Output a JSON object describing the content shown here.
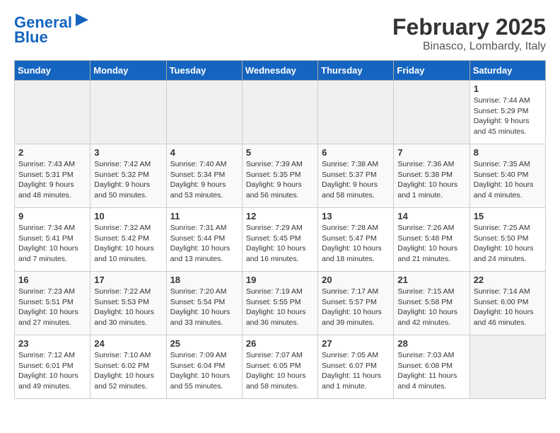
{
  "logo": {
    "line1": "General",
    "line2": "Blue"
  },
  "title": "February 2025",
  "subtitle": "Binasco, Lombardy, Italy",
  "weekdays": [
    "Sunday",
    "Monday",
    "Tuesday",
    "Wednesday",
    "Thursday",
    "Friday",
    "Saturday"
  ],
  "weeks": [
    [
      {
        "num": "",
        "info": ""
      },
      {
        "num": "",
        "info": ""
      },
      {
        "num": "",
        "info": ""
      },
      {
        "num": "",
        "info": ""
      },
      {
        "num": "",
        "info": ""
      },
      {
        "num": "",
        "info": ""
      },
      {
        "num": "1",
        "info": "Sunrise: 7:44 AM\nSunset: 5:29 PM\nDaylight: 9 hours and 45 minutes."
      }
    ],
    [
      {
        "num": "2",
        "info": "Sunrise: 7:43 AM\nSunset: 5:31 PM\nDaylight: 9 hours and 48 minutes."
      },
      {
        "num": "3",
        "info": "Sunrise: 7:42 AM\nSunset: 5:32 PM\nDaylight: 9 hours and 50 minutes."
      },
      {
        "num": "4",
        "info": "Sunrise: 7:40 AM\nSunset: 5:34 PM\nDaylight: 9 hours and 53 minutes."
      },
      {
        "num": "5",
        "info": "Sunrise: 7:39 AM\nSunset: 5:35 PM\nDaylight: 9 hours and 56 minutes."
      },
      {
        "num": "6",
        "info": "Sunrise: 7:38 AM\nSunset: 5:37 PM\nDaylight: 9 hours and 58 minutes."
      },
      {
        "num": "7",
        "info": "Sunrise: 7:36 AM\nSunset: 5:38 PM\nDaylight: 10 hours and 1 minute."
      },
      {
        "num": "8",
        "info": "Sunrise: 7:35 AM\nSunset: 5:40 PM\nDaylight: 10 hours and 4 minutes."
      }
    ],
    [
      {
        "num": "9",
        "info": "Sunrise: 7:34 AM\nSunset: 5:41 PM\nDaylight: 10 hours and 7 minutes."
      },
      {
        "num": "10",
        "info": "Sunrise: 7:32 AM\nSunset: 5:42 PM\nDaylight: 10 hours and 10 minutes."
      },
      {
        "num": "11",
        "info": "Sunrise: 7:31 AM\nSunset: 5:44 PM\nDaylight: 10 hours and 13 minutes."
      },
      {
        "num": "12",
        "info": "Sunrise: 7:29 AM\nSunset: 5:45 PM\nDaylight: 10 hours and 16 minutes."
      },
      {
        "num": "13",
        "info": "Sunrise: 7:28 AM\nSunset: 5:47 PM\nDaylight: 10 hours and 18 minutes."
      },
      {
        "num": "14",
        "info": "Sunrise: 7:26 AM\nSunset: 5:48 PM\nDaylight: 10 hours and 21 minutes."
      },
      {
        "num": "15",
        "info": "Sunrise: 7:25 AM\nSunset: 5:50 PM\nDaylight: 10 hours and 24 minutes."
      }
    ],
    [
      {
        "num": "16",
        "info": "Sunrise: 7:23 AM\nSunset: 5:51 PM\nDaylight: 10 hours and 27 minutes."
      },
      {
        "num": "17",
        "info": "Sunrise: 7:22 AM\nSunset: 5:53 PM\nDaylight: 10 hours and 30 minutes."
      },
      {
        "num": "18",
        "info": "Sunrise: 7:20 AM\nSunset: 5:54 PM\nDaylight: 10 hours and 33 minutes."
      },
      {
        "num": "19",
        "info": "Sunrise: 7:19 AM\nSunset: 5:55 PM\nDaylight: 10 hours and 36 minutes."
      },
      {
        "num": "20",
        "info": "Sunrise: 7:17 AM\nSunset: 5:57 PM\nDaylight: 10 hours and 39 minutes."
      },
      {
        "num": "21",
        "info": "Sunrise: 7:15 AM\nSunset: 5:58 PM\nDaylight: 10 hours and 42 minutes."
      },
      {
        "num": "22",
        "info": "Sunrise: 7:14 AM\nSunset: 6:00 PM\nDaylight: 10 hours and 46 minutes."
      }
    ],
    [
      {
        "num": "23",
        "info": "Sunrise: 7:12 AM\nSunset: 6:01 PM\nDaylight: 10 hours and 49 minutes."
      },
      {
        "num": "24",
        "info": "Sunrise: 7:10 AM\nSunset: 6:02 PM\nDaylight: 10 hours and 52 minutes."
      },
      {
        "num": "25",
        "info": "Sunrise: 7:09 AM\nSunset: 6:04 PM\nDaylight: 10 hours and 55 minutes."
      },
      {
        "num": "26",
        "info": "Sunrise: 7:07 AM\nSunset: 6:05 PM\nDaylight: 10 hours and 58 minutes."
      },
      {
        "num": "27",
        "info": "Sunrise: 7:05 AM\nSunset: 6:07 PM\nDaylight: 11 hours and 1 minute."
      },
      {
        "num": "28",
        "info": "Sunrise: 7:03 AM\nSunset: 6:08 PM\nDaylight: 11 hours and 4 minutes."
      },
      {
        "num": "",
        "info": ""
      }
    ]
  ]
}
